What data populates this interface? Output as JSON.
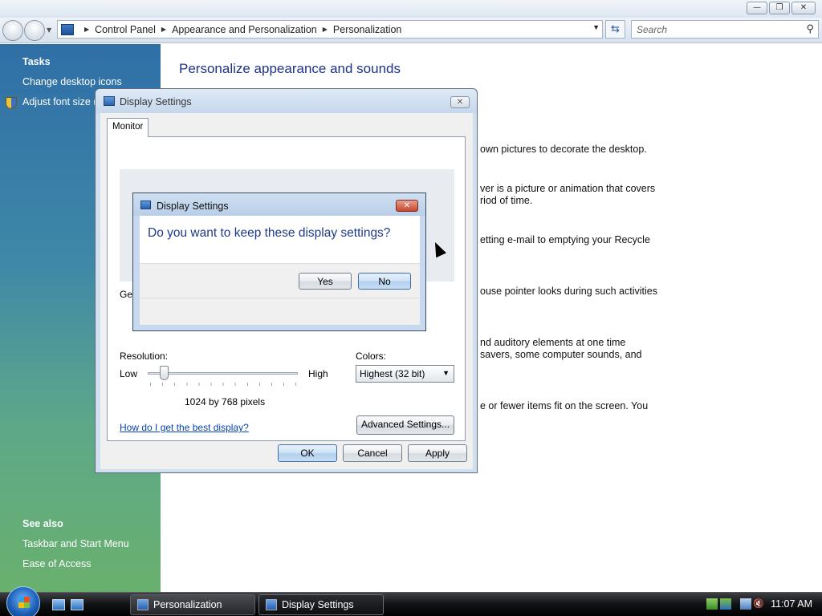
{
  "window": {
    "address": {
      "crumbs": [
        "Control Panel",
        "Appearance and Personalization",
        "Personalization"
      ]
    },
    "search_placeholder": "Search"
  },
  "left_pane": {
    "tasks_heading": "Tasks",
    "tasks": [
      "Change desktop icons",
      "Adjust font size (DPI)"
    ],
    "see_also_heading": "See also",
    "see_also": [
      "Taskbar and Start Menu",
      "Ease of Access"
    ]
  },
  "main": {
    "title": "Personalize appearance and sounds",
    "fragments": [
      "own pictures to decorate the desktop.",
      "ver is a picture or animation that covers",
      "riod of time.",
      "etting e-mail to emptying your Recycle",
      "ouse pointer looks during such activities",
      "nd auditory elements at one time",
      "savers, some computer sounds, and",
      "e or fewer items fit on the screen. You"
    ]
  },
  "display_settings": {
    "title": "Display Settings",
    "tab": "Monitor",
    "general_label": "Ger",
    "resolution_label": "Resolution:",
    "low": "Low",
    "high": "High",
    "resolution_value": "1024 by 768 pixels",
    "slider_level": 0.11,
    "colors_label": "Colors:",
    "colors_value": "Highest (32 bit)",
    "help_link": "How do I get the best display?",
    "advanced_button": "Advanced Settings...",
    "ok": "OK",
    "cancel": "Cancel",
    "apply": "Apply"
  },
  "confirm_dialog": {
    "title": "Display Settings",
    "question": "Do you want to keep these display settings?",
    "yes": "Yes",
    "no": "No"
  },
  "taskbar": {
    "tasks": [
      "Personalization",
      "Display Settings"
    ],
    "clock": "11:07 AM"
  },
  "icons": {
    "close": "close-icon",
    "search": "search-icon",
    "refresh": "refresh-icon",
    "shield": "uac-shield-icon"
  }
}
